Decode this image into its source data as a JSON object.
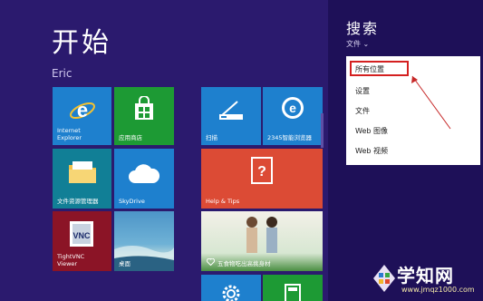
{
  "start": {
    "title": "开始",
    "user": "Eric"
  },
  "tiles": [
    {
      "name": "tile-internet-explorer",
      "label": "Internet\nExplorer",
      "color": "#1e80ce",
      "icon": "ie-icon"
    },
    {
      "name": "tile-app-store",
      "label": "应用商店",
      "color": "#1d9a34",
      "icon": "store-bag-icon"
    },
    {
      "name": "tile-scan",
      "label": "扫描",
      "color": "#1e80ce",
      "icon": "scanner-icon"
    },
    {
      "name": "tile-2345-browser",
      "label": "2345智能浏览器",
      "color": "#1e80ce",
      "icon": "browser-e-icon"
    },
    {
      "name": "tile-file-explorer",
      "label": "文件资源管理器",
      "color": "#117f96",
      "icon": "folder-icon"
    },
    {
      "name": "tile-skydrive",
      "label": "SkyDrive",
      "color": "#1e80ce",
      "icon": "cloud-icon"
    },
    {
      "name": "tile-help-tips",
      "label": "Help & Tips",
      "color": "#dc4b35",
      "icon": "help-book-icon"
    },
    {
      "name": "tile-tightvnc",
      "label": "TightVNC\nViewer",
      "color": "#8b1426",
      "icon": "vnc-icon"
    },
    {
      "name": "tile-desktop",
      "label": "桌面",
      "color": "#3b7eb0",
      "icon": "desktop-photo"
    },
    {
      "name": "tile-food",
      "label": "五食物吃出高挑身材",
      "color": "#4a8f42",
      "icon": "heart-icon"
    },
    {
      "name": "tile-settings",
      "label": "",
      "color": "#1e80ce",
      "icon": "gear-icon"
    },
    {
      "name": "tile-calculator",
      "label": "",
      "color": "#1d9a34",
      "icon": "calculator-icon"
    }
  ],
  "search": {
    "title": "搜索",
    "scope": "文件 ⌄",
    "menu_items": [
      "所有位置",
      "设置",
      "文件",
      "Web 图像",
      "Web 视频"
    ]
  },
  "watermark": {
    "text": "学知网",
    "url": "www.jmqz1000.com"
  }
}
